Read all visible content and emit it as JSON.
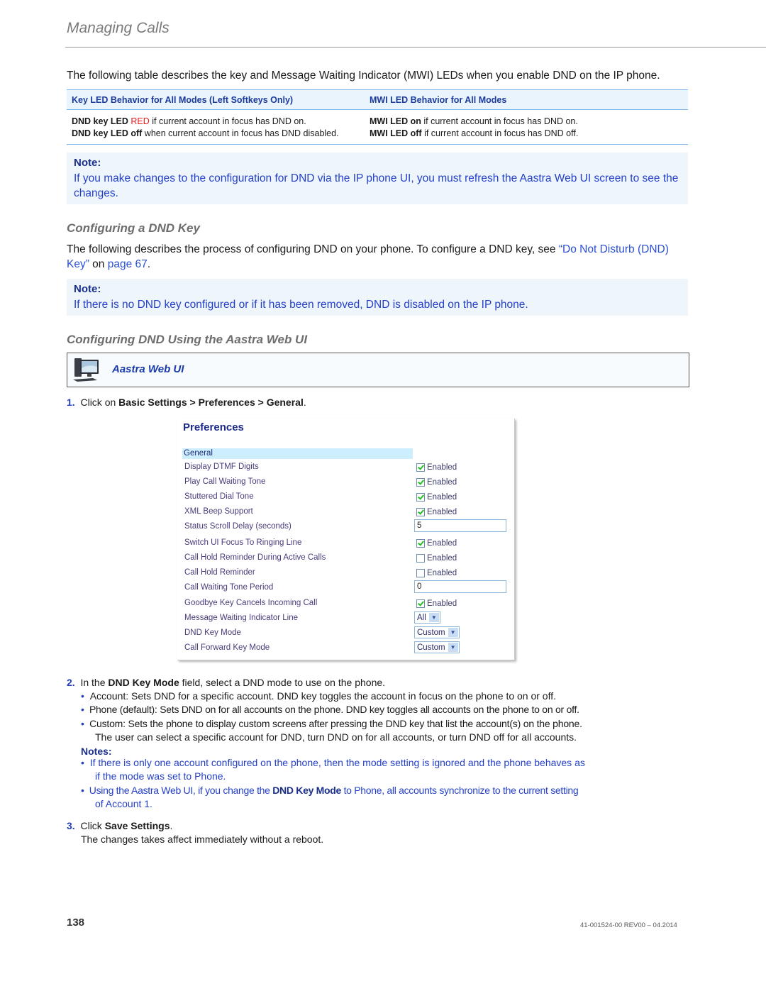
{
  "header": {
    "title": "Managing Calls"
  },
  "intro": "The following table describes the key and Message Waiting Indicator (MWI) LEDs when you enable DND on the IP phone.",
  "led_table": {
    "columns": [
      "Key LED Behavior for All Modes (Left Softkeys Only)",
      "MWI LED Behavior for All Modes"
    ],
    "col1_rows": [
      {
        "bold": "DND key LED ",
        "highlight": "RED",
        "text": " if current account in focus has DND on."
      },
      {
        "bold": "DND key LED off",
        "highlight": "",
        "text": " when current account in focus has DND disabled."
      }
    ],
    "col2_rows": [
      {
        "bold": "MWI LED on",
        "text": " if current account in focus has DND on."
      },
      {
        "bold": "MWI LED off",
        "text": " if current account in focus has DND off."
      }
    ],
    "highlight_color": "#e61e1e"
  },
  "note1": {
    "label": "Note:",
    "text": "If you make changes to the configuration for DND via the IP phone UI, you must refresh the Aastra Web UI screen to see the changes."
  },
  "section1": {
    "heading": "Configuring a DND Key",
    "text_before": "The following describes the process of configuring DND on your phone. To configure a DND key, see ",
    "link1": "“Do Not Disturb (DND) Key”",
    "text_mid": " on ",
    "link2": "page 67",
    "text_after": "."
  },
  "note2": {
    "label": "Note:",
    "text": "If there is no DND key configured or if it has been removed, DND is disabled on the IP phone."
  },
  "section2": {
    "heading": "Configuring DND Using the Aastra Web UI"
  },
  "aastra_box": {
    "icon": "computer-icon",
    "label": "Aastra Web UI"
  },
  "step1": {
    "num": "1.",
    "prefix": "Click on ",
    "bold": "Basic Settings > Preferences > General",
    "suffix": "."
  },
  "preferences": {
    "title": "Preferences",
    "section": "General",
    "rows": [
      {
        "label": "Display DTMF Digits",
        "type": "checkbox",
        "checked": true,
        "ctrl_label": "Enabled"
      },
      {
        "label": "Play Call Waiting Tone",
        "type": "checkbox",
        "checked": true,
        "ctrl_label": "Enabled"
      },
      {
        "label": "Stuttered Dial Tone",
        "type": "checkbox",
        "checked": true,
        "ctrl_label": "Enabled"
      },
      {
        "label": "XML Beep Support",
        "type": "checkbox",
        "checked": true,
        "ctrl_label": "Enabled"
      },
      {
        "label": "Status Scroll Delay (seconds)",
        "type": "text",
        "value": "5"
      },
      {
        "label": "Switch UI Focus To Ringing Line",
        "type": "checkbox",
        "checked": true,
        "ctrl_label": "Enabled"
      },
      {
        "label": "Call Hold Reminder During Active Calls",
        "type": "checkbox",
        "checked": false,
        "ctrl_label": "Enabled"
      },
      {
        "label": "Call Hold Reminder",
        "type": "checkbox",
        "checked": false,
        "ctrl_label": "Enabled"
      },
      {
        "label": "Call Waiting Tone Period",
        "type": "text",
        "value": "0"
      },
      {
        "label": "Goodbye Key Cancels Incoming Call",
        "type": "checkbox",
        "checked": true,
        "ctrl_label": "Enabled"
      },
      {
        "label": "Message Waiting Indicator Line",
        "type": "select",
        "value": "All"
      },
      {
        "label": "DND Key Mode",
        "type": "select",
        "value": "Custom"
      },
      {
        "label": "Call Forward Key Mode",
        "type": "select",
        "value": "Custom"
      }
    ]
  },
  "step2": {
    "num": "2.",
    "prefix": "In the ",
    "bold": "DND Key Mode",
    "suffix": " field, select a DND mode to use on the phone.",
    "bullets": [
      "Account: Sets DND for a specific account. DND key toggles the account in focus on the phone to on or off.",
      "Phone (default): Sets DND on for all accounts on the phone. DND key toggles all accounts on the phone to on or off.",
      "Custom: Sets the phone to display custom screens after pressing the DND key that list the account(s) on the phone.",
      "The user can select a specific account for DND, turn DND on for all accounts, or turn DND off for all accounts."
    ],
    "notes_label": "Notes:",
    "note_bullets": [
      {
        "line1": "If there is only one account configured on the phone, then the mode setting is ignored and the phone behaves as",
        "line2": "if the mode was set to Phone."
      },
      {
        "line1_pre": "Using the Aastra Web UI, if you change the ",
        "line1_bold": "DND Key Mode",
        "line1_post": " to Phone, all accounts synchronize to the current setting",
        "line2": "of Account 1."
      }
    ],
    "bullet_glyph": "•"
  },
  "step3": {
    "num": "3.",
    "prefix": "Click ",
    "bold": "Save Settings",
    "suffix": ".",
    "line2": "The changes takes affect immediately without a reboot."
  },
  "footer": {
    "page": "138",
    "doc": "41-001524-00 REV00 – 04.2014"
  }
}
